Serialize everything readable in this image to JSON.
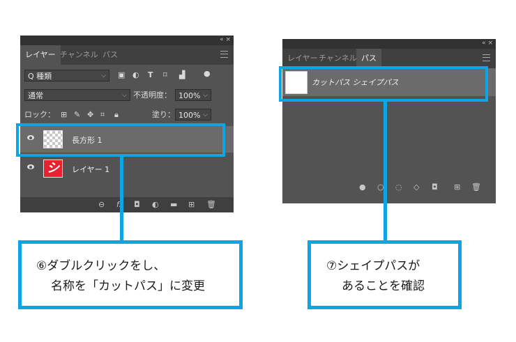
{
  "layers_panel": {
    "top_controls": "«  ×",
    "tabs": [
      "レイヤー",
      "チャンネル",
      "パス"
    ],
    "filter": {
      "value": "Q 種類"
    },
    "blend_mode": {
      "value": "通常"
    },
    "opacity": {
      "label": "不透明度：",
      "value": "100%"
    },
    "lock_label": "ロック：",
    "fill": {
      "label": "塗り：",
      "value": "100%"
    },
    "layers": [
      {
        "name": "長方形 1",
        "selected": true,
        "thumb": "transparent"
      },
      {
        "name": "レイヤー 1",
        "selected": false,
        "thumb": "シ"
      }
    ]
  },
  "paths_panel": {
    "top_controls": "«  ×",
    "tabs": [
      "レイヤー",
      "チャンネル",
      "パス"
    ],
    "paths": [
      {
        "name": "カットパス シェイプパス",
        "selected": true
      }
    ]
  },
  "callouts": {
    "left": {
      "line1": "⑥ダブルクリックをし、",
      "line2": "名称を「カットパス」に変更"
    },
    "right": {
      "line1": "⑦シェイプパスが",
      "line2": "あることを確認"
    }
  },
  "colors": {
    "accent": "#0ea5e4",
    "panel": "#535353",
    "selected_row": "#6b6b6b"
  }
}
